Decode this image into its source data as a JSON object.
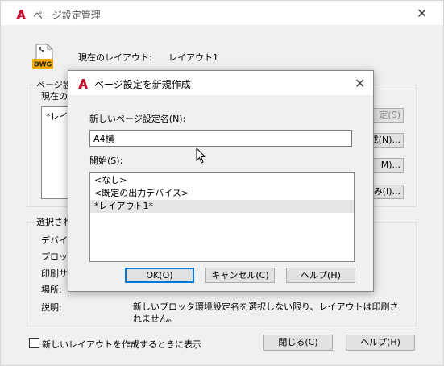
{
  "outer": {
    "title": "ページ設定管理",
    "current_layout_label": "現在のレイアウト:",
    "current_layout_value": "レイアウト1",
    "page_setup_group_title": "ページ設定",
    "current_page_setup_label": "現在の",
    "list_items": [
      "*レイ"
    ],
    "right_buttons": [
      "定(S)",
      "成(N)...",
      "M)...",
      "み(I)..."
    ],
    "selected_group_title": "選択され",
    "detail_labels": [
      "デバイス",
      "プロッタ",
      "印刷サ",
      "場所:",
      "説明:"
    ],
    "description_text": "新しいプロッタ環境設定名を選択しない限り、レイアウトは印刷されません。",
    "show_on_new_layout_label": "新しいレイアウトを作成するときに表示",
    "close_button": "閉じる(C)",
    "help_button": "ヘルプ(H)"
  },
  "dialog": {
    "title": "ページ設定を新規作成",
    "name_label": "新しいページ設定名(N):",
    "name_value": "A4横",
    "start_label": "開始(S):",
    "start_items": [
      "<なし>",
      "<既定の出力デバイス>",
      "*レイアウト1*"
    ],
    "selected_index": 2,
    "ok_button": "OK(O)",
    "cancel_button": "キャンセル(C)",
    "help_button": "ヘルプ(H)"
  },
  "colors": {
    "accent": "#0078d7",
    "autocad_red": "#c8102e",
    "dialog_bg": "#f0f0f0"
  },
  "icons": {
    "app": "autocad-logo-icon",
    "dwg": "dwg-file-icon",
    "close": "close-icon",
    "cursor": "mouse-cursor-icon"
  }
}
